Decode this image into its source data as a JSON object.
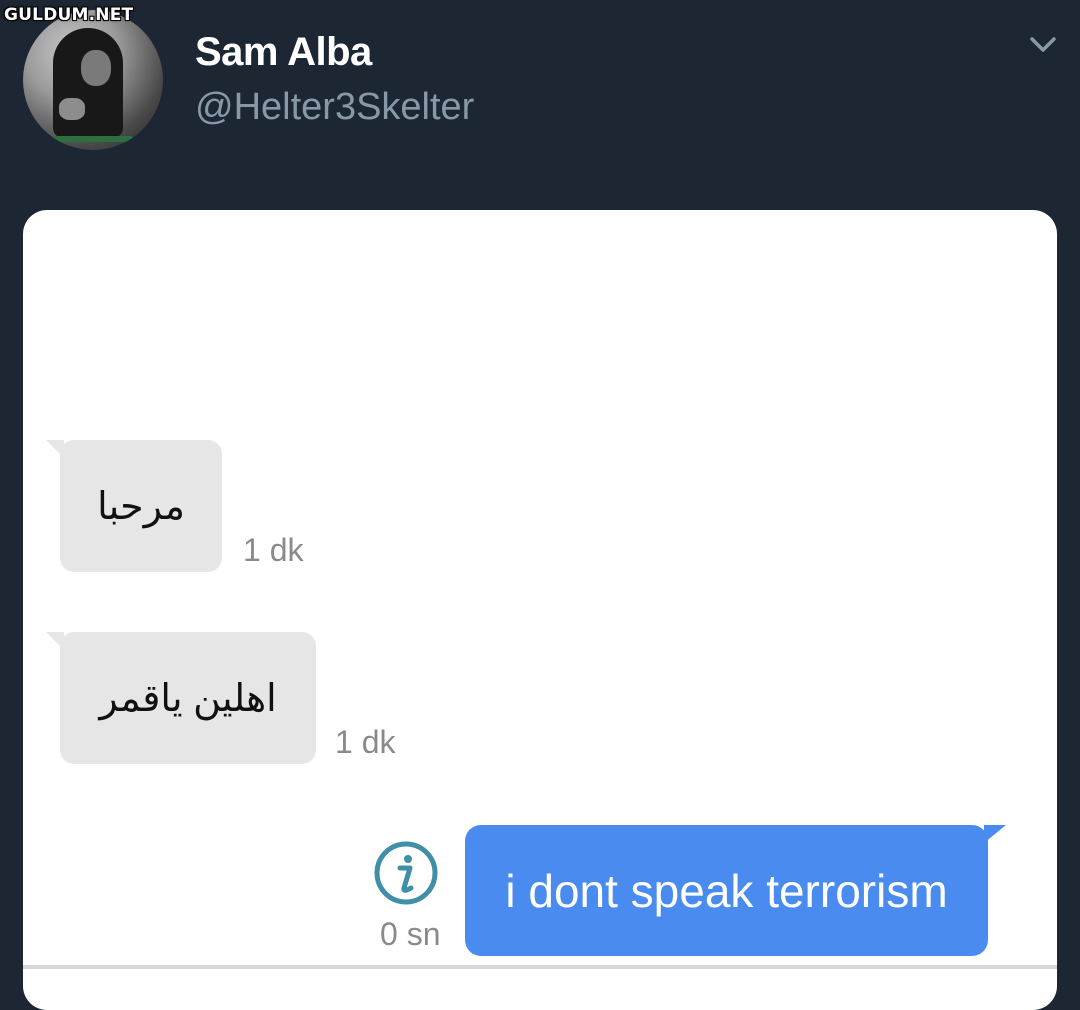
{
  "watermark": "GULDUM.NET",
  "profile": {
    "display_name": "Sam Alba",
    "handle": "@Helter3Skelter"
  },
  "icons": {
    "menu": "chevron-down-icon",
    "message_info": "info-icon"
  },
  "colors": {
    "background": "#1c2733",
    "incoming_bubble": "#e6e6e6",
    "outgoing_bubble": "#4a8bf0",
    "info_icon": "#3f8fa6",
    "handle_text": "#8899a6"
  },
  "messages": [
    {
      "direction": "incoming",
      "text": "مرحبا",
      "time": "1 dk"
    },
    {
      "direction": "incoming",
      "text": "اهلين ياقمر",
      "time": "1 dk"
    },
    {
      "direction": "outgoing",
      "text": "i dont speak terrorism",
      "time": "0 sn"
    }
  ]
}
